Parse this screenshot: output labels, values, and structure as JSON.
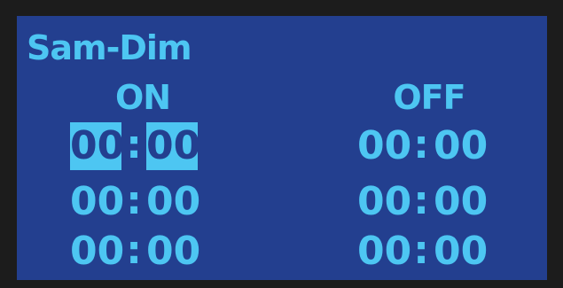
{
  "title": "Sam-Dim",
  "columns": {
    "on_label": "ON",
    "off_label": "OFF"
  },
  "schedule": [
    {
      "on": {
        "hh": "00",
        "mm": "00"
      },
      "off": {
        "hh": "00",
        "mm": "00"
      }
    },
    {
      "on": {
        "hh": "00",
        "mm": "00"
      },
      "off": {
        "hh": "00",
        "mm": "00"
      }
    },
    {
      "on": {
        "hh": "00",
        "mm": "00"
      },
      "off": {
        "hh": "00",
        "mm": "00"
      }
    }
  ],
  "separator": ":",
  "colors": {
    "background": "#233f8f",
    "foreground": "#4dc6f2",
    "bezel": "#1c1c1c"
  }
}
